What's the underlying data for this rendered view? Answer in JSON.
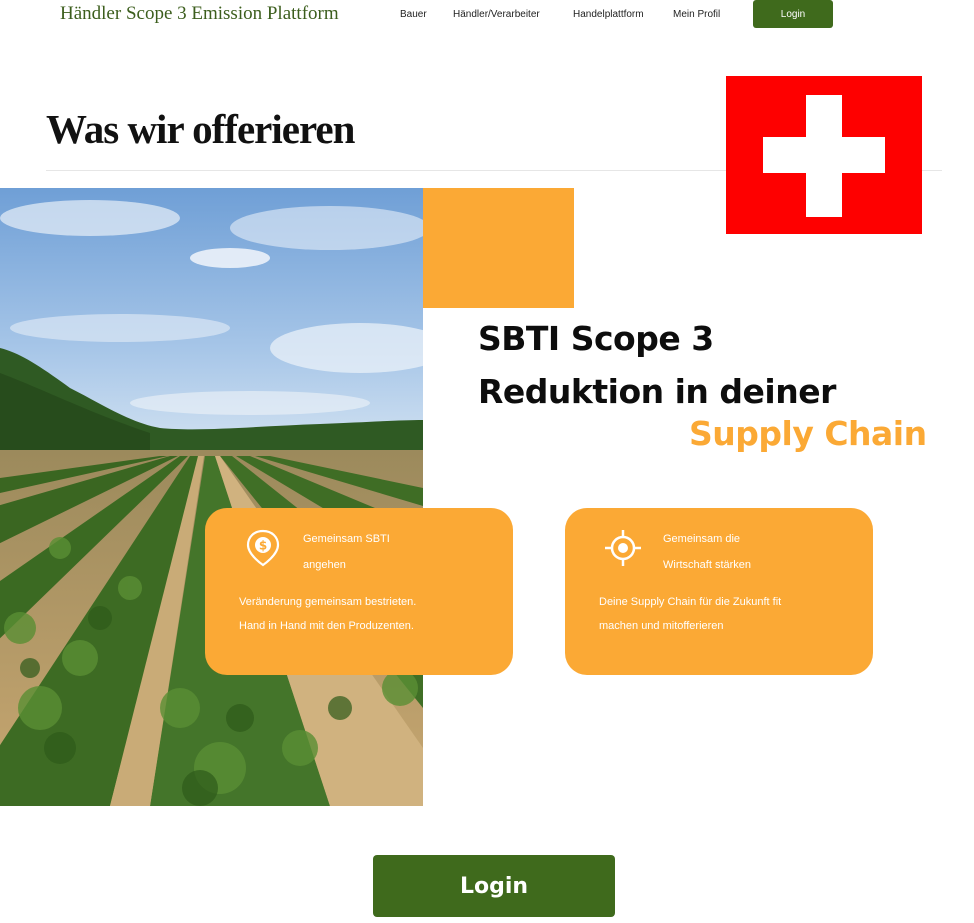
{
  "header": {
    "brand": "Händler Scope 3 Emission Plattform",
    "nav": [
      "Bauer",
      "Händler/Verarbeiter",
      "Handelplattform",
      "Mein Profil"
    ],
    "login_label": "Login"
  },
  "section": {
    "title": "Was wir offerieren"
  },
  "headline": {
    "line1": "SBTI Scope 3",
    "line2": "Reduktion in deiner",
    "accent": "Supply Chain"
  },
  "cards": [
    {
      "icon": "coin-pin-icon",
      "title_line1": "Gemeinsam SBTI",
      "title_line2": "angehen",
      "text_line1": "Veränderung gemeinsam bestrieten.",
      "text_line2": "Hand in Hand mit den Produzenten."
    },
    {
      "icon": "target-icon",
      "title_line1": "Gemeinsam die",
      "title_line2": "Wirtschaft stärken",
      "text_line1": "Deine Supply Chain für die Zukunft fit",
      "text_line2": "machen und mitofferieren"
    }
  ],
  "cta": {
    "login_label": "Login"
  },
  "colors": {
    "brand_green": "#3f6a1c",
    "accent_orange": "#fba935",
    "flag_red": "#fe0000"
  }
}
